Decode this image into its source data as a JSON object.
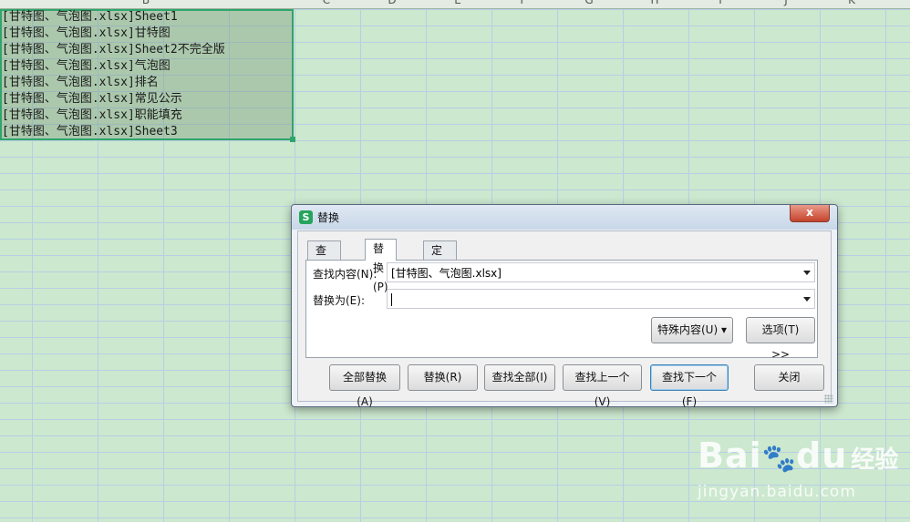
{
  "sheet": {
    "column_headers": [
      "B",
      "C",
      "D",
      "E",
      "F",
      "G",
      "H",
      "I",
      "J",
      "K"
    ],
    "cells": [
      "[甘特图、气泡图.xlsx]Sheet1",
      "[甘特图、气泡图.xlsx]甘特图",
      "[甘特图、气泡图.xlsx]Sheet2不完全版",
      "[甘特图、气泡图.xlsx]气泡图",
      "[甘特图、气泡图.xlsx]排名",
      "[甘特图、气泡图.xlsx]常见公示",
      "[甘特图、气泡图.xlsx]职能填充",
      "[甘特图、气泡图.xlsx]Sheet3"
    ]
  },
  "dialog": {
    "app_icon": "S",
    "title": "替换",
    "close": "x",
    "tabs": [
      "查找(D)",
      "替换(P)",
      "定位(G)"
    ],
    "active_tab": 1,
    "find_label": "查找内容(N):",
    "find_value": "[甘特图、气泡图.xlsx]",
    "replace_label": "替换为(E):",
    "replace_value": "",
    "special_button": "特殊内容(U) ▾",
    "options_button": "选项(T) >>",
    "buttons": {
      "replace_all": "全部替换(A)",
      "replace": "替换(R)",
      "find_all": "查找全部(I)",
      "find_prev": "查找上一个(V)",
      "find_next": "查找下一个(F)",
      "close": "关闭"
    }
  },
  "watermark": {
    "logo": "Bai",
    "logo2": "du",
    "cn": "经验",
    "url": "jingyan.baidu.com"
  }
}
